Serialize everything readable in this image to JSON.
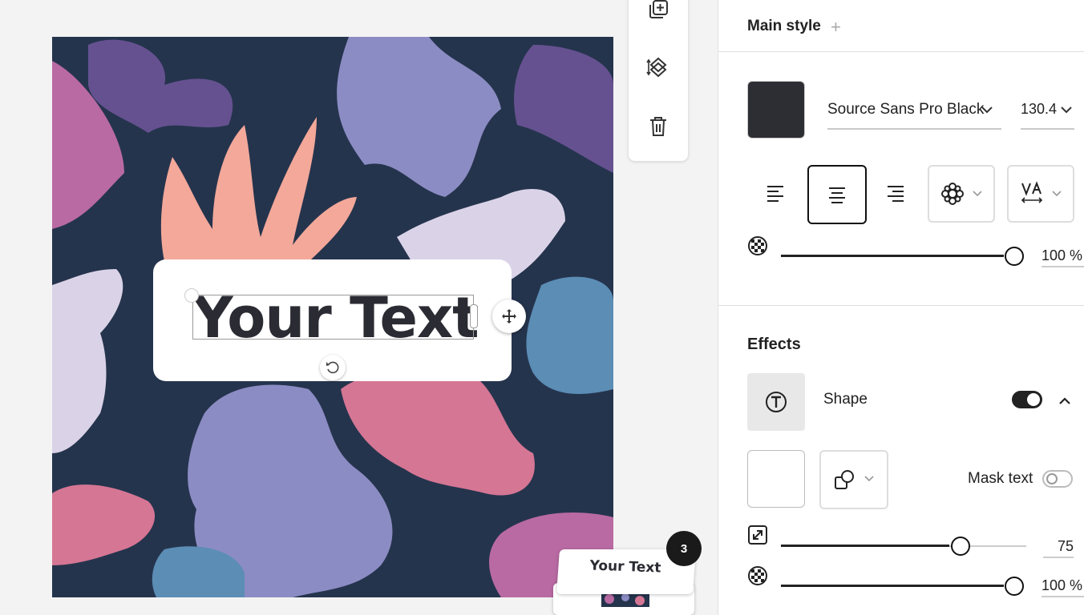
{
  "canvas": {
    "text_content": "Your Text",
    "page_count": "3",
    "thumbnail_text": "Your Text"
  },
  "toolbar": {
    "icons": [
      "add-page-icon",
      "layers-icon",
      "trash-icon"
    ]
  },
  "panel": {
    "main_style_label": "Main style",
    "add_icon": "+",
    "font_family": "Source Sans Pro Black",
    "font_size": "130.4",
    "swatch_color": "#2d2d34",
    "opacity_value": "100 %",
    "opacity_level": 1.0,
    "effects_title": "Effects",
    "shape_label": "Shape",
    "shape_toggle_on": true,
    "mask_text_label": "Mask text",
    "mask_toggle_on": false,
    "shape_size_value": "75",
    "shape_size_level": 0.75,
    "shape_opacity_value": "100 %",
    "shape_opacity_level": 1.0
  },
  "colors": {
    "artboard_bg": "#25344d",
    "accent_dark": "#222222"
  }
}
